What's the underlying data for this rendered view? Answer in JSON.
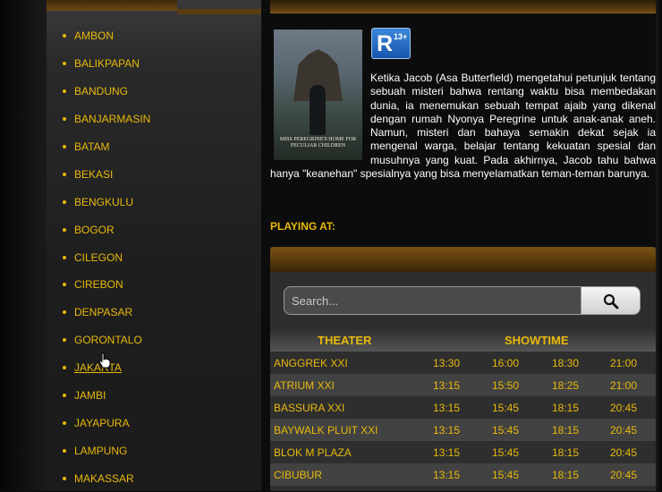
{
  "sidebar": {
    "cities": [
      "AMBON",
      "BALIKPAPAN",
      "BANDUNG",
      "BANJARMASIN",
      "BATAM",
      "BEKASI",
      "BENGKULU",
      "BOGOR",
      "CILEGON",
      "CIREBON",
      "DENPASAR",
      "GORONTALO",
      "JAKARTA",
      "JAMBI",
      "JAYAPURA",
      "LAMPUNG",
      "MAKASSAR"
    ],
    "active_city": "JAKARTA"
  },
  "movie": {
    "poster_text": "MISS PEREGRINE'S HOME FOR PECULIAR CHILDREN",
    "rating_letter": "R",
    "rating_age": "13+",
    "synopsis": "Ketika Jacob (Asa Butterfield) mengetahui petunjuk tentang sebuah misteri bahwa rentang waktu bisa membedakan dunia, ia menemukan sebuah tempat ajaib yang dikenal dengan rumah Nyonya Peregrine untuk anak-anak aneh. Namun, misteri dan bahaya semakin dekat sejak ia mengenal warga, belajar tentang kekuatan spesial dan musuhnya yang kuat. Pada akhirnya, Jacob tahu bahwa hanya \"keanehan\" spesialnya yang bisa menyelamatkan teman-teman barunya."
  },
  "playing_at_label": "PLAYING AT:",
  "search": {
    "placeholder": "Search..."
  },
  "table": {
    "theater_header": "THEATER",
    "showtime_header": "SHOWTIME",
    "rows": [
      {
        "theater": "ANGGREK XXI",
        "times": [
          "13:30",
          "16:00",
          "18:30",
          "21:00"
        ]
      },
      {
        "theater": "ATRIUM XXI",
        "times": [
          "13:15",
          "15:50",
          "18:25",
          "21:00"
        ]
      },
      {
        "theater": "BASSURA XXI",
        "times": [
          "13:15",
          "15:45",
          "18:15",
          "20:45"
        ]
      },
      {
        "theater": "BAYWALK PLUIT XXI",
        "times": [
          "13:15",
          "15:45",
          "18:15",
          "20:45"
        ]
      },
      {
        "theater": "BLOK M PLAZA",
        "times": [
          "13:15",
          "15:45",
          "18:15",
          "20:45"
        ]
      },
      {
        "theater": "CIBUBUR",
        "times": [
          "13:15",
          "15:45",
          "18:15",
          "20:45"
        ]
      }
    ]
  },
  "colors": {
    "accent": "#e8b90a",
    "header_brown": "#6b4a14",
    "rating_blue": "#1e6fd0"
  },
  "icons": {
    "search": "search-icon",
    "cursor": "hand-cursor-icon"
  }
}
